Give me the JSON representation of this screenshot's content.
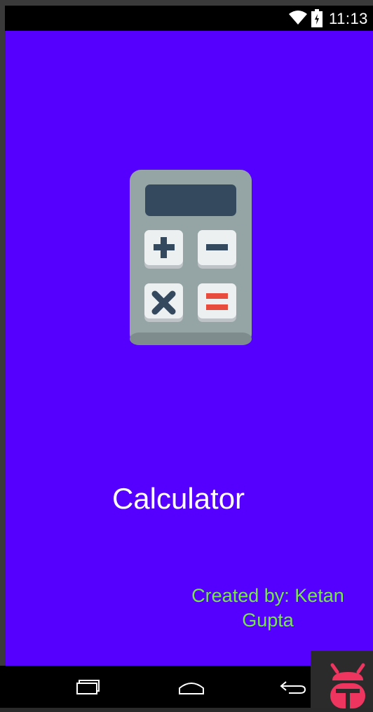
{
  "status_bar": {
    "time": "11:13",
    "icons": [
      "wifi-icon",
      "battery-icon"
    ]
  },
  "splash": {
    "app_icon": "calculator-icon",
    "title": "Calculator",
    "credit": "Created by: Ketan Gupta",
    "background_color": "#5500ff",
    "credit_color": "#76e84a"
  },
  "nav_bar": {
    "buttons": [
      "recents-icon",
      "home-icon",
      "back-icon"
    ]
  },
  "overlay": {
    "icon": "bug-icon"
  }
}
